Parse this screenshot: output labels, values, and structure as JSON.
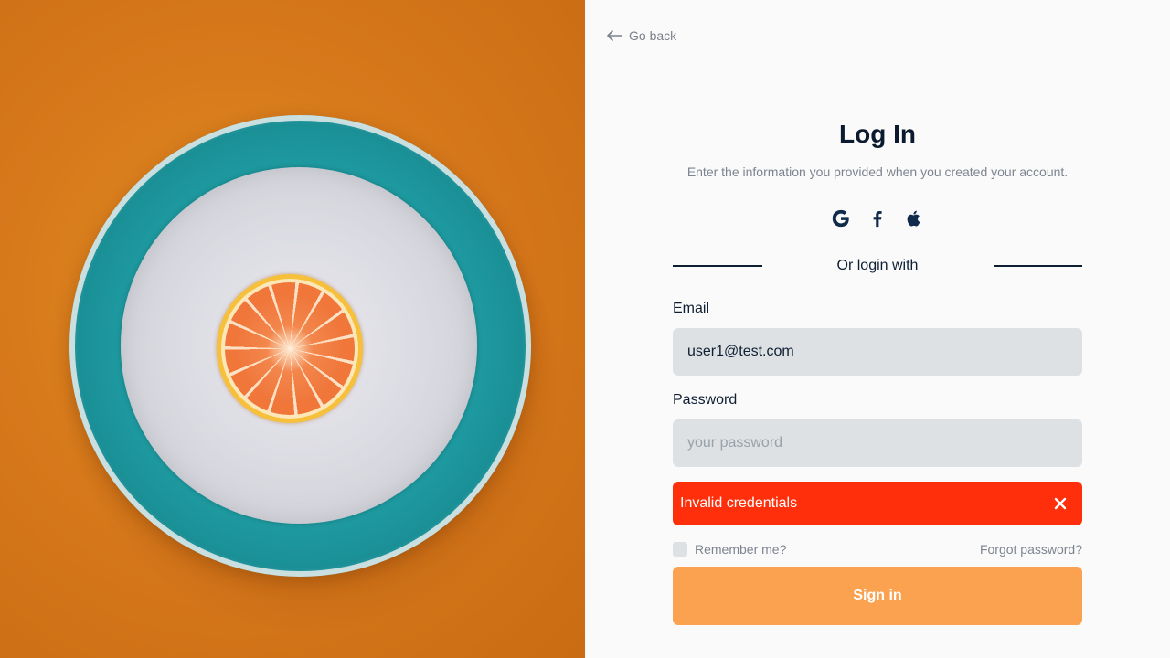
{
  "hero": {
    "image_alt": ""
  },
  "nav": {
    "go_back_label": "Go back"
  },
  "header": {
    "title": "Log In",
    "subtitle": "Enter the information you provided when you created your account."
  },
  "social": {
    "icons": [
      "google-icon",
      "facebook-icon",
      "apple-icon"
    ]
  },
  "divider": {
    "label": "Or login with"
  },
  "form": {
    "email_label": "Email",
    "email_value": "user1@test.com",
    "password_label": "Password",
    "password_value": "",
    "password_placeholder": "your password",
    "remember_label": "Remember me?",
    "remember_checked": false,
    "forgot_label": "Forgot password?",
    "submit_label": "Sign in"
  },
  "alert": {
    "message": "Invalid credentials"
  },
  "colors": {
    "accent": "#fba250",
    "error": "#ff2f0b",
    "text_dark": "#0f1f33",
    "text_muted": "#7d8490",
    "field_bg": "#dde1e3"
  }
}
